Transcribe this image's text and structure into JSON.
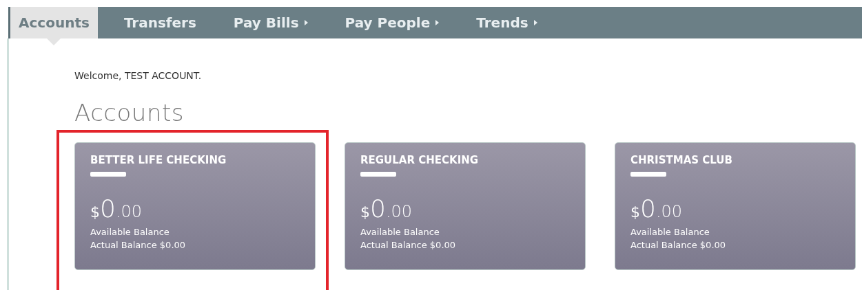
{
  "nav": {
    "tabs": [
      {
        "label": "Accounts",
        "selected": true,
        "has_menu": false
      },
      {
        "label": "Transfers",
        "selected": false,
        "has_menu": false
      },
      {
        "label": "Pay Bills",
        "selected": false,
        "has_menu": true
      },
      {
        "label": "Pay People",
        "selected": false,
        "has_menu": true
      },
      {
        "label": "Trends",
        "selected": false,
        "has_menu": true
      }
    ]
  },
  "welcome": "Welcome, TEST ACCOUNT.",
  "heading": "Accounts",
  "accounts": [
    {
      "name": "BETTER LIFE CHECKING",
      "number_redacted": true,
      "highlighted": true,
      "balance": {
        "symbol": "$",
        "whole": "0",
        "fraction": ".00"
      },
      "available_label": "Available Balance",
      "actual": "Actual Balance $0.00"
    },
    {
      "name": "REGULAR CHECKING",
      "number_redacted": true,
      "highlighted": false,
      "balance": {
        "symbol": "$",
        "whole": "0",
        "fraction": ".00"
      },
      "available_label": "Available Balance",
      "actual": "Actual Balance $0.00"
    },
    {
      "name": "CHRISTMAS CLUB",
      "number_redacted": true,
      "highlighted": false,
      "balance": {
        "symbol": "$",
        "whole": "0",
        "fraction": ".00"
      },
      "available_label": "Available Balance",
      "actual": "Actual Balance $0.00"
    }
  ]
}
